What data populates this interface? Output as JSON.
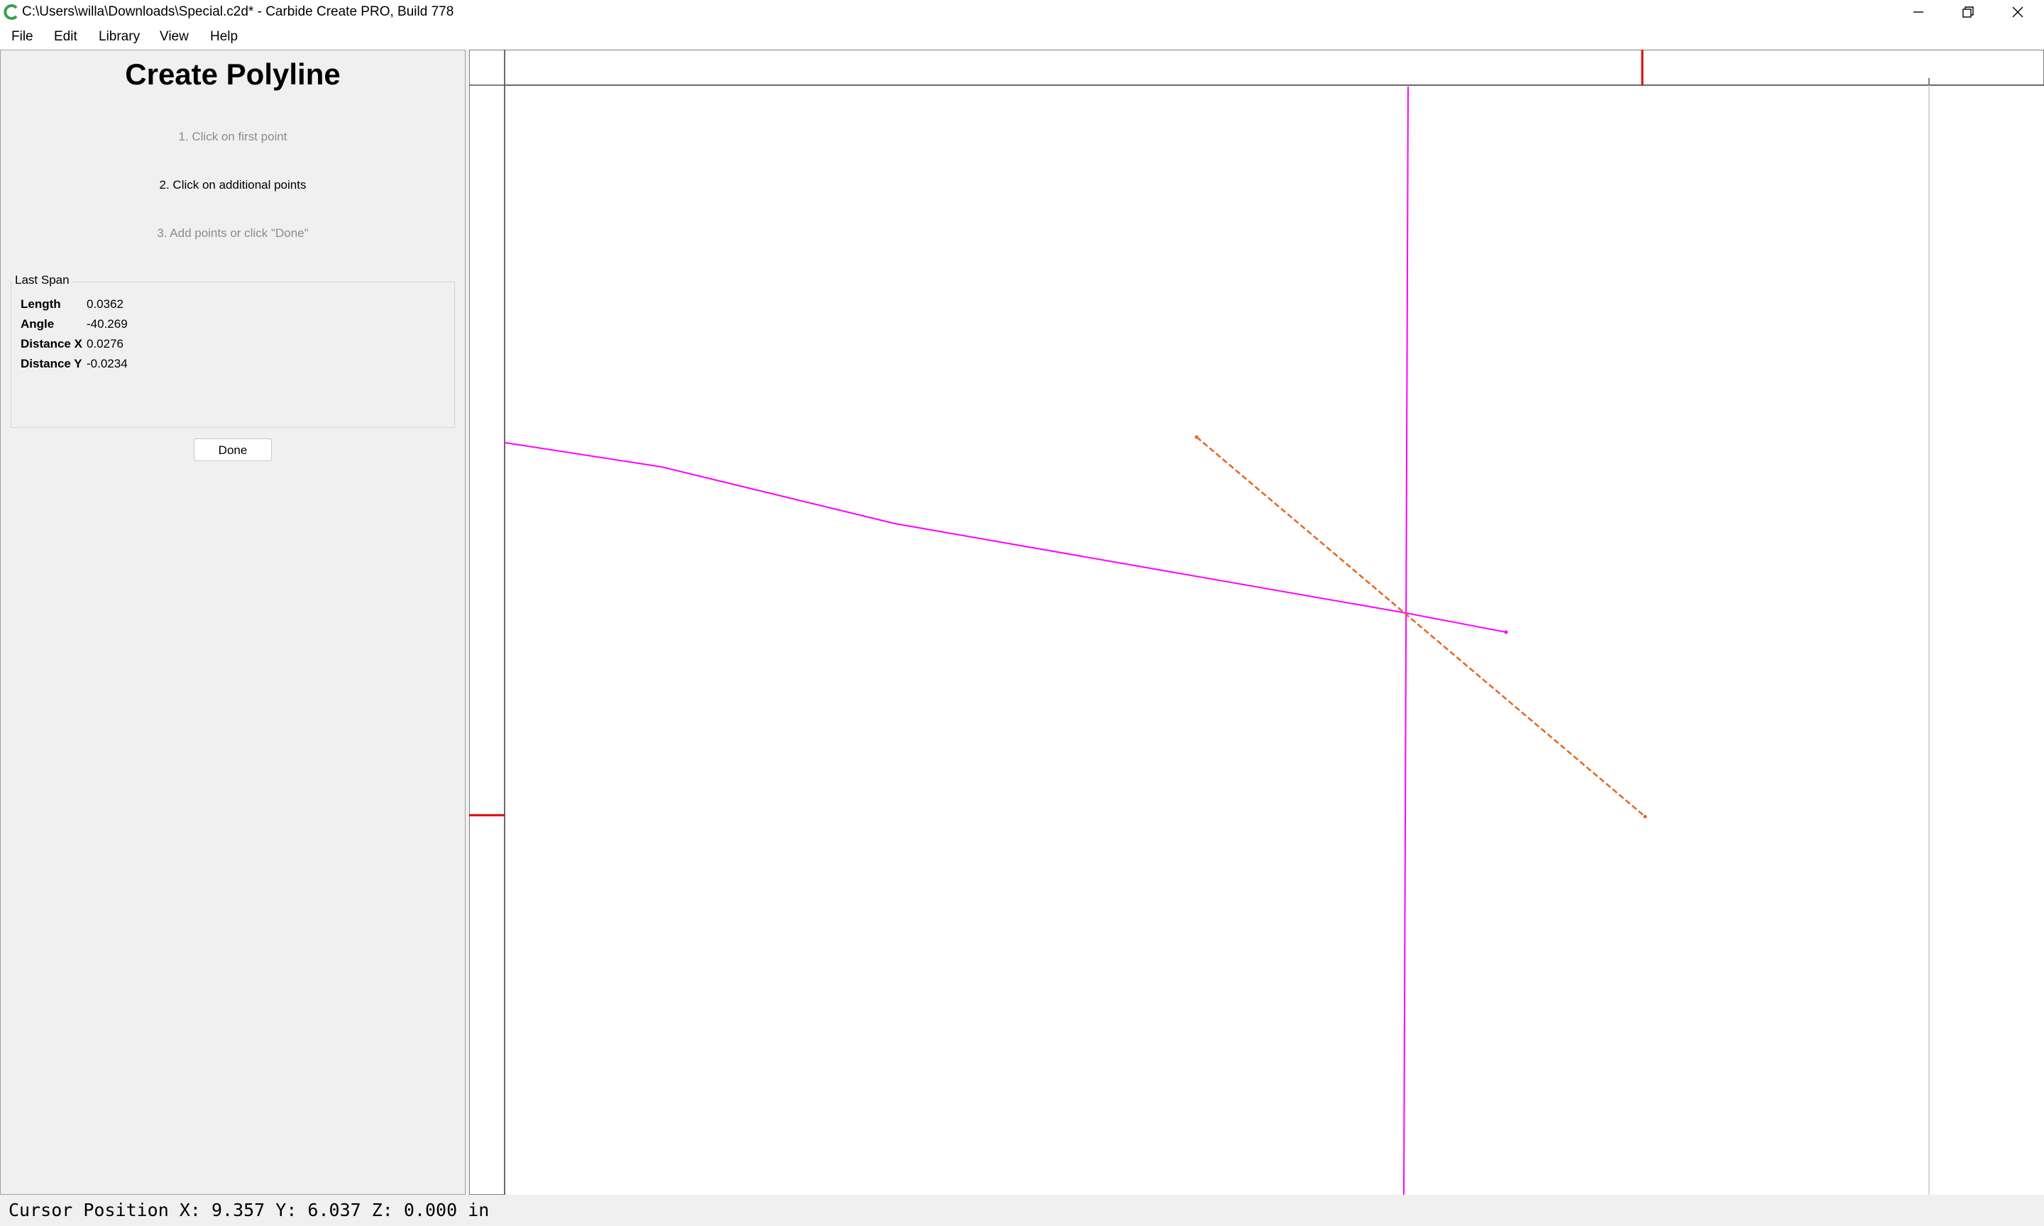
{
  "window": {
    "title": "C:\\Users\\willa\\Downloads\\Special.c2d* - Carbide Create PRO, Build 778",
    "icon": "carbide-create-logo",
    "accent_color": "#3aa04a"
  },
  "menu": {
    "items": [
      {
        "label": "File"
      },
      {
        "label": "Edit"
      },
      {
        "label": "Library"
      },
      {
        "label": "View"
      },
      {
        "label": "Help"
      }
    ]
  },
  "sidebar": {
    "title": "Create Polyline",
    "steps": [
      {
        "label": "1. Click on first point",
        "state": "done"
      },
      {
        "label": "2. Click on additional points",
        "state": "active"
      },
      {
        "label": "3. Add points or click \"Done\"",
        "state": "pending"
      }
    ],
    "last_span": {
      "legend": "Last Span",
      "rows": [
        {
          "key": "Length",
          "value": "0.0362"
        },
        {
          "key": "Angle",
          "value": "-40.269"
        },
        {
          "key": "Distance X",
          "value": "0.0276"
        },
        {
          "key": "Distance Y",
          "value": "-0.0234"
        }
      ]
    },
    "done_label": "Done"
  },
  "canvas": {
    "polyline_color": "#ff00ff",
    "preview_color": "#e8641e",
    "axis_marker_color": "#e00000"
  },
  "status": {
    "cursor_position": "Cursor Position X: 9.357 Y: 6.037 Z: 0.000 in"
  }
}
